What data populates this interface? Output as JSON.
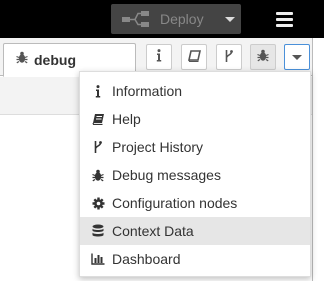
{
  "header": {
    "deploy_label": "Deploy",
    "menu_icon": "hamburger-icon"
  },
  "sidebar": {
    "active_tab": {
      "label": "debug",
      "icon": "bug-icon"
    },
    "tab_buttons": [
      {
        "name": "info",
        "icon": "info-icon"
      },
      {
        "name": "help",
        "icon": "book-icon"
      },
      {
        "name": "project-history",
        "icon": "branch-icon"
      },
      {
        "name": "debug",
        "icon": "bug-icon"
      },
      {
        "name": "more",
        "icon": "chevron-down-icon"
      }
    ]
  },
  "dropdown": {
    "items": [
      {
        "label": "Information",
        "icon": "info-icon"
      },
      {
        "label": "Help",
        "icon": "book-icon"
      },
      {
        "label": "Project History",
        "icon": "branch-icon"
      },
      {
        "label": "Debug messages",
        "icon": "bug-icon"
      },
      {
        "label": "Configuration nodes",
        "icon": "gear-icon"
      },
      {
        "label": "Context Data",
        "icon": "database-icon",
        "highlighted": true
      },
      {
        "label": "Dashboard",
        "icon": "bar-chart-icon"
      }
    ]
  },
  "colors": {
    "header_bg": "#000000",
    "deploy_bg": "#444444",
    "highlight": "#e6e6e6",
    "accent_border": "#4a90d9"
  }
}
